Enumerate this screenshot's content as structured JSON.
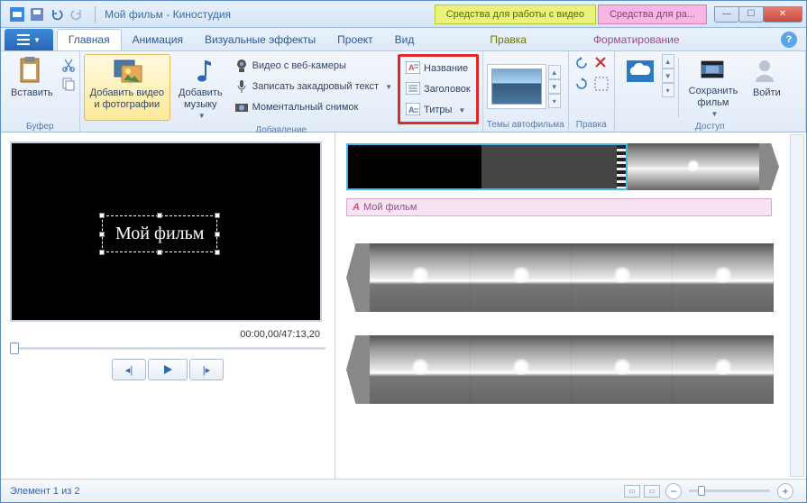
{
  "window": {
    "title": "Мой фильм - Киностудия",
    "context_tab_video": "Средства для работы с видео",
    "context_tab_text": "Средства для ра..."
  },
  "tabs": {
    "home": "Главная",
    "animation": "Анимация",
    "effects": "Визуальные эффекты",
    "project": "Проект",
    "view": "Вид",
    "edit": "Правка",
    "format": "Форматирование"
  },
  "ribbon": {
    "buffer": {
      "label": "Буфер",
      "paste": "Вставить"
    },
    "add": {
      "label": "Добавление",
      "add_media": "Добавить видео\nи фотографии",
      "add_music": "Добавить\nмузыку",
      "webcam": "Видео с веб-камеры",
      "voiceover": "Записать закадровый текст",
      "snapshot": "Моментальный снимок",
      "title_btn": "Название",
      "caption_btn": "Заголовок",
      "credits_btn": "Титры"
    },
    "themes": {
      "label": "Темы автофильма"
    },
    "editgrp": {
      "label": "Правка"
    },
    "access": {
      "label": "Доступ",
      "save_movie": "Сохранить\nфильм",
      "signin": "Войти"
    }
  },
  "preview": {
    "text": "Мой фильм",
    "timecode": "00:00,00/47:13,20"
  },
  "timeline": {
    "caption": "Мой фильм"
  },
  "status": {
    "counter": "Элемент 1 из 2"
  }
}
